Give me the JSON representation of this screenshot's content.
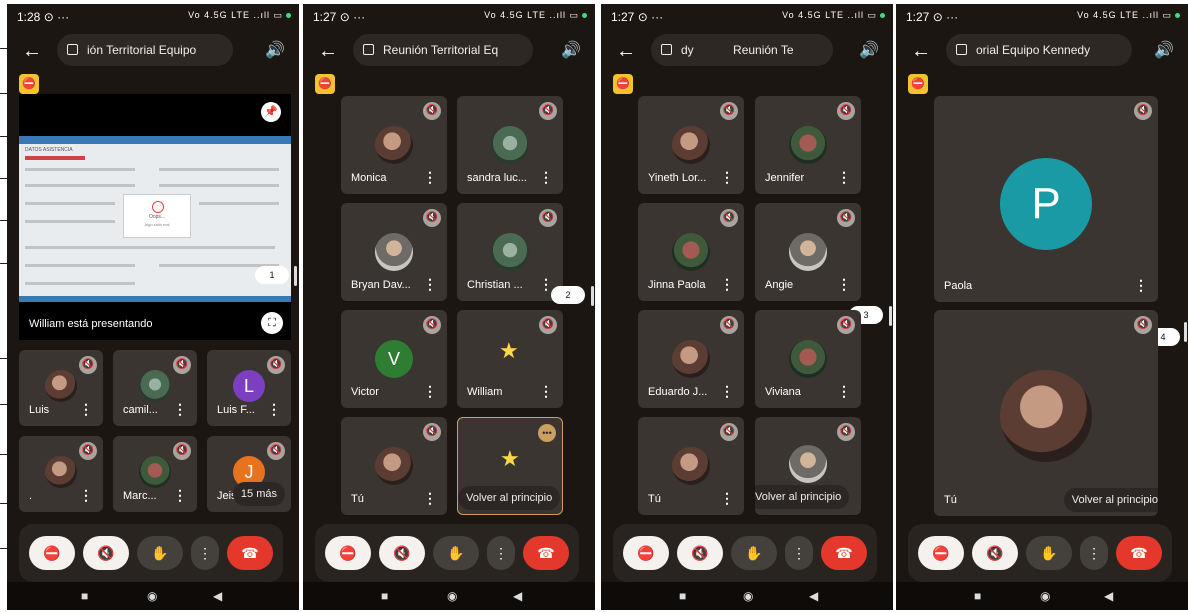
{
  "rules_count": 11,
  "icons": {
    "back": "arrow-left-icon",
    "calendar": "calendar-icon",
    "speaker": "speaker-icon",
    "camera_off": "camera-off-icon",
    "mic_off": "mic-off-icon",
    "more": "more-vertical-icon",
    "hand": "raise-hand-icon",
    "hangup": "hang-up-icon",
    "pin": "pin-icon",
    "fullscreen": "fullscreen-icon",
    "speaking": "speaking-icon"
  },
  "colors": {
    "background": "#1c1612",
    "tile": "#3b3531",
    "camera_badge": "#f3c22c",
    "hangup": "#e5382c",
    "avatar_teal": "#1a9aa5",
    "avatar_green": "#2e7d32",
    "avatar_purple": "#7b3fbf",
    "avatar_orange": "#e8731e"
  },
  "glyphs": {
    "back": "←",
    "speaker": "🔊",
    "camera_off": "⛔",
    "mic_off": "🔇",
    "more": "⋮",
    "hand": "✋",
    "hangup": "☎",
    "pin": "📌",
    "fullscreen": "⛶",
    "speaking": "•••",
    "star": "★",
    "nav_square": "■",
    "nav_circle": "◉",
    "nav_back": "◀"
  },
  "phone1": {
    "time": "1:28 ⊙ ···",
    "signal": "Vo 4.5G LTE ..ıll ▭",
    "title": "ión Territorial Equipo",
    "screen_share": {
      "presenting_text": "William está presentando",
      "form_header": "DATOS ASISTENCIA",
      "dialog_title": "Oops...",
      "dialog_text": "Algo salió mal"
    },
    "page_number": "1",
    "tiles": [
      {
        "name": "Luis"
      },
      {
        "name": "camil..."
      },
      {
        "name": "Luis F...",
        "letter": "L"
      },
      {
        "name": "."
      },
      {
        "name": "Marc..."
      },
      {
        "name": "Jeis",
        "letter": "J",
        "more_label": "15 más"
      }
    ]
  },
  "phone2": {
    "time": "1:27 ⊙ ···",
    "signal": "Vo 4.5G LTE ..ıll ▭",
    "title": "Reunión Territorial Eq",
    "page_number": "2",
    "tiles": [
      {
        "name": "Monica"
      },
      {
        "name": "sandra luc..."
      },
      {
        "name": "Bryan Dav..."
      },
      {
        "name": "Christian ..."
      },
      {
        "name": "Victor",
        "letter": "V"
      },
      {
        "name": "William"
      },
      {
        "name": "Tú"
      },
      {
        "name": "Volver al principio"
      }
    ]
  },
  "phone3": {
    "time": "1:27 ⊙ ···",
    "signal": "Vo 4.5G LTE ..ıll ▭",
    "title_left": "dy",
    "title_right": "Reunión Te",
    "page_number": "3",
    "tiles": [
      {
        "name": "Yineth Lor..."
      },
      {
        "name": "Jennifer"
      },
      {
        "name": "Jinna Paola"
      },
      {
        "name": "Angie"
      },
      {
        "name": "Eduardo J..."
      },
      {
        "name": "Viviana"
      },
      {
        "name": "Tú"
      },
      {
        "name": "Volver al principio"
      }
    ]
  },
  "phone4": {
    "time": "1:27 ⊙ ···",
    "signal": "Vo 4.5G LTE ..ıll ▭",
    "title": "orial Equipo Kennedy",
    "page_number": "4",
    "tiles": [
      {
        "name": "Paola",
        "letter": "P"
      },
      {
        "name": "Tú"
      }
    ],
    "back_label": "Volver al principio"
  }
}
